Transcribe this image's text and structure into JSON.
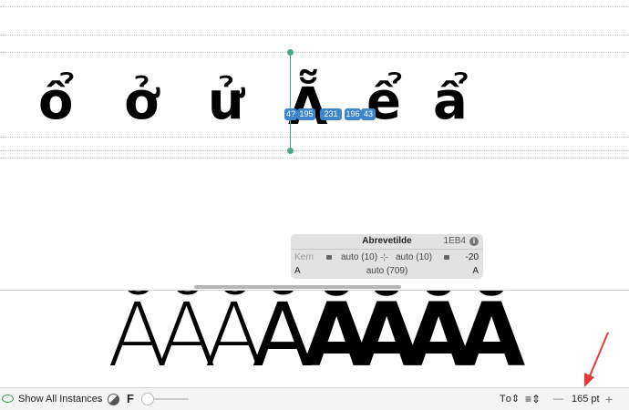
{
  "editor": {
    "glyphs": [
      "ổ",
      "ở",
      "ử",
      "Ẵ",
      "ể",
      "ẩ"
    ],
    "metrics": [
      "4?",
      "195",
      "231",
      "196",
      "43"
    ]
  },
  "info_panel": {
    "glyph_name": "Abrevetilde",
    "unicode": "1EB4",
    "info_icon": "info-icon",
    "kern_label": "Kern",
    "left_kern": "auto (10)",
    "right_kern": "auto (10)",
    "kern_value": "-20",
    "left_group": "A",
    "width": "auto (709)",
    "right_group": "A"
  },
  "preview": {
    "glyph": "Ă",
    "weights": [
      "100",
      "200",
      "300",
      "500",
      "600",
      "700",
      "800",
      "900"
    ]
  },
  "bottom_bar": {
    "show_label": "Show All Instances",
    "f_label": "F",
    "size": "165 pt",
    "minus": "—",
    "plus": "+"
  },
  "colors": {
    "accent": "#3c86cc",
    "guide": "#4aa88a",
    "annotation": "#e53935"
  }
}
